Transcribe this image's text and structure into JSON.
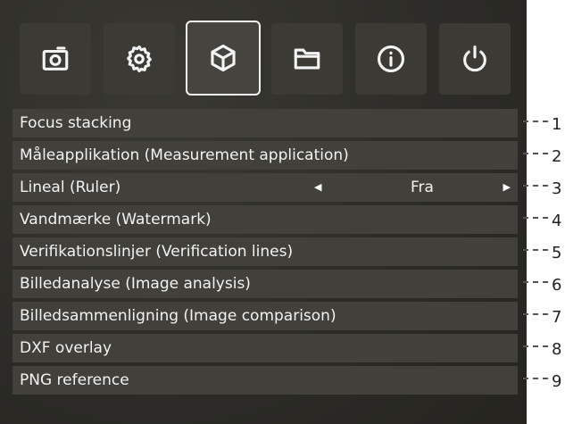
{
  "toolbar": {
    "buttons": [
      {
        "icon": "camera-icon"
      },
      {
        "icon": "gear-icon"
      },
      {
        "icon": "cube-icon",
        "active": true
      },
      {
        "icon": "folder-icon"
      },
      {
        "icon": "info-icon"
      },
      {
        "icon": "power-icon"
      }
    ]
  },
  "menu": {
    "items": [
      {
        "label": "Focus stacking"
      },
      {
        "label": "Måleapplikation (Measurement application)"
      },
      {
        "label": "Lineal (Ruler)",
        "value": "Fra"
      },
      {
        "label": "Vandmærke (Watermark)"
      },
      {
        "label": "Verifikationslinjer (Verification lines)"
      },
      {
        "label": "Billedanalyse (Image analysis)"
      },
      {
        "label": "Billedsammenligning (Image comparison)"
      },
      {
        "label": "DXF overlay"
      },
      {
        "label": "PNG reference"
      }
    ]
  },
  "callouts": [
    "1",
    "2",
    "3",
    "4",
    "5",
    "6",
    "7",
    "8",
    "9"
  ]
}
